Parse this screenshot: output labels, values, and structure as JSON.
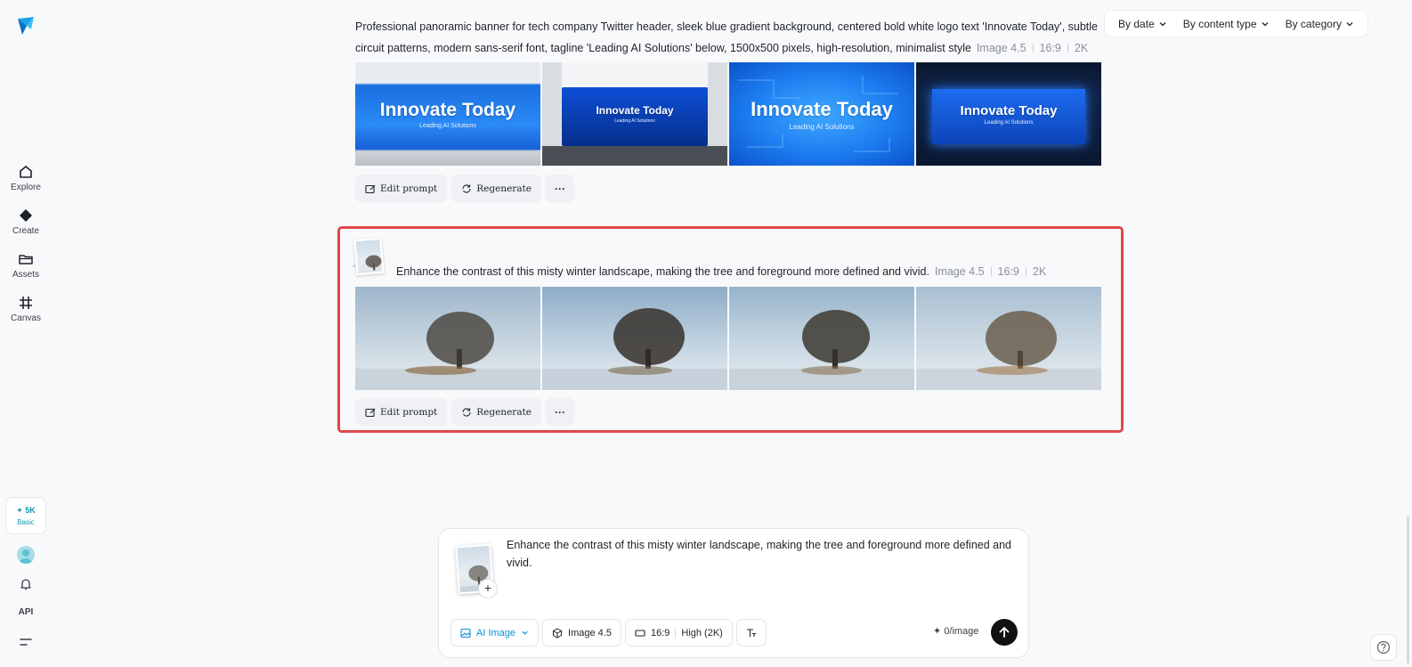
{
  "sidebar": {
    "items": [
      {
        "label": "Explore",
        "icon": "home-icon"
      },
      {
        "label": "Create",
        "icon": "diamond-icon"
      },
      {
        "label": "Assets",
        "icon": "folder-icon"
      },
      {
        "label": "Canvas",
        "icon": "canvas-icon"
      }
    ],
    "credits_amount": "✦ 5K",
    "plan": "Basic",
    "api_label": "API"
  },
  "filters": [
    {
      "label": "By date"
    },
    {
      "label": "By content type"
    },
    {
      "label": "By category"
    }
  ],
  "generations": [
    {
      "prompt": "Professional panoramic banner for tech company Twitter header, sleek blue gradient background, centered bold white logo text 'Innovate Today', subtle circuit patterns, modern sans-serif font, tagline 'Leading AI Solutions' below, 1500x500 pixels, high-resolution, minimalist style",
      "model": "Image 4.5",
      "ratio": "16:9",
      "quality": "2K",
      "images": [
        {
          "title": "Innovate Today",
          "subtitle": "Leading AI Solutions"
        },
        {
          "title": "Innovate Today",
          "subtitle": "Leading AI Solutions"
        },
        {
          "title": "Innovate Today",
          "subtitle": "Leading AI Solutions"
        },
        {
          "title": "Innovate Today",
          "subtitle": "Leading AI Solutions"
        }
      ],
      "actions": {
        "edit": "Edit prompt",
        "regenerate": "Regenerate",
        "more": "···"
      }
    },
    {
      "prompt": "Enhance the contrast of this misty winter landscape, making the tree and foreground more defined and vivid.",
      "model": "Image 4.5",
      "ratio": "16:9",
      "quality": "2K",
      "actions": {
        "edit": "Edit prompt",
        "regenerate": "Regenerate",
        "more": "···"
      }
    }
  ],
  "composer": {
    "text": "Enhance the contrast of this misty winter landscape, making the tree and foreground more defined and vivid.",
    "add": "+",
    "mode": "AI Image",
    "model": "Image 4.5",
    "ratio": "16:9",
    "quality": "High (2K)",
    "cost": "✦ 0/image"
  },
  "colors": {
    "accent": "#0b8fd6",
    "highlight": "#e04848",
    "teal": "#0e9aa7"
  }
}
